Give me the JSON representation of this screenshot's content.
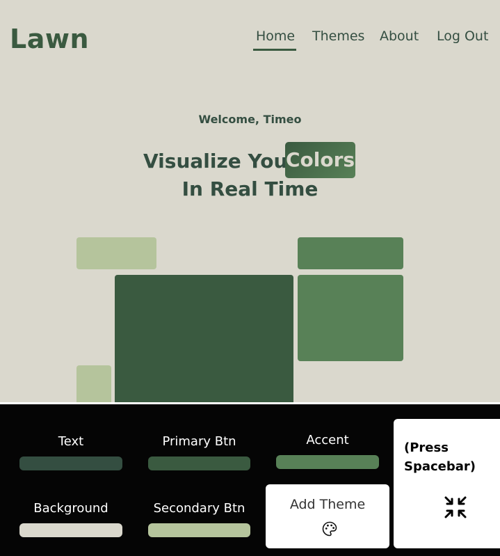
{
  "header": {
    "logo": "Lawn",
    "nav": [
      {
        "label": "Home",
        "active": true
      },
      {
        "label": "Themes",
        "active": false
      },
      {
        "label": "About",
        "active": false
      },
      {
        "label": "Log Out",
        "active": false
      }
    ]
  },
  "hero": {
    "welcome": "Welcome, Timeo",
    "headline_line1": "Visualize Your",
    "headline_highlight": "Colors",
    "headline_line2": "In Real Time"
  },
  "palette": {
    "text": {
      "label": "Text",
      "color": "#344e41"
    },
    "primary": {
      "label": "Primary Btn",
      "color": "#3a5a40"
    },
    "accent": {
      "label": "Accent",
      "color": "#588157"
    },
    "background": {
      "label": "Background",
      "color": "#dad8cd"
    },
    "secondary": {
      "label": "Secondary Btn",
      "color": "#b5c49c"
    }
  },
  "actions": {
    "add_theme": "Add Theme",
    "add_theme_icon": "palette-icon",
    "spacebar_hint": "(Press Spacebar)",
    "spacebar_icon": "shrink-arrows-icon"
  }
}
